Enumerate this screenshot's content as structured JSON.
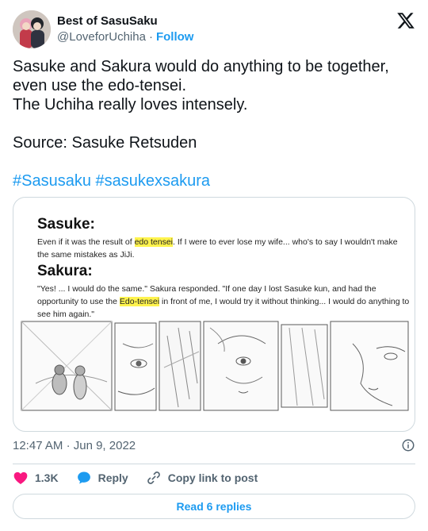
{
  "author": {
    "display_name": "Best of SasuSaku",
    "handle": "@LoveforUchiha",
    "separator": "·",
    "follow_label": "Follow",
    "avatar_icon": "avatar-illustration"
  },
  "tweet": {
    "lines": [
      "Sasuke and Sakura would do anything to be together,",
      "even use the edo-tensei.",
      "The Uchiha really loves intensely.",
      "",
      "Source: Sasuke Retsuden",
      ""
    ],
    "hashtags": [
      "#Sasusaku",
      "#sasukexsakura"
    ]
  },
  "media": {
    "sasuke": {
      "heading": "Sasuke:",
      "body_before": "Even if it was the result of ",
      "highlight": "edo tensei",
      "body_after": ". If I were to ever lose my wife... who's to say I wouldn't make the same mistakes as JiJi."
    },
    "sakura": {
      "heading": "Sakura:",
      "body_before": "\"Yes! ... I would do the same.\" Sakura responded. \"If one day I lost Sasuke kun, and had the opportunity to use the ",
      "highlight": "Edo-tensei",
      "body_after": " in front of me, I would try it without thinking... I would do anything to see him again.\""
    },
    "highlight_color": "#fff34d"
  },
  "meta": {
    "time": "12:47 AM",
    "separator": "·",
    "date": "Jun 9, 2022"
  },
  "actions": {
    "like_count": "1.3K",
    "reply_label": "Reply",
    "copy_label": "Copy link to post",
    "like_color": "#f91880",
    "reply_color": "#1d9bf0"
  },
  "read_replies_label": "Read 6 replies",
  "colors": {
    "accent": "#1d9bf0",
    "text": "#0f1419",
    "muted": "#536471",
    "border": "#cfd9de"
  }
}
